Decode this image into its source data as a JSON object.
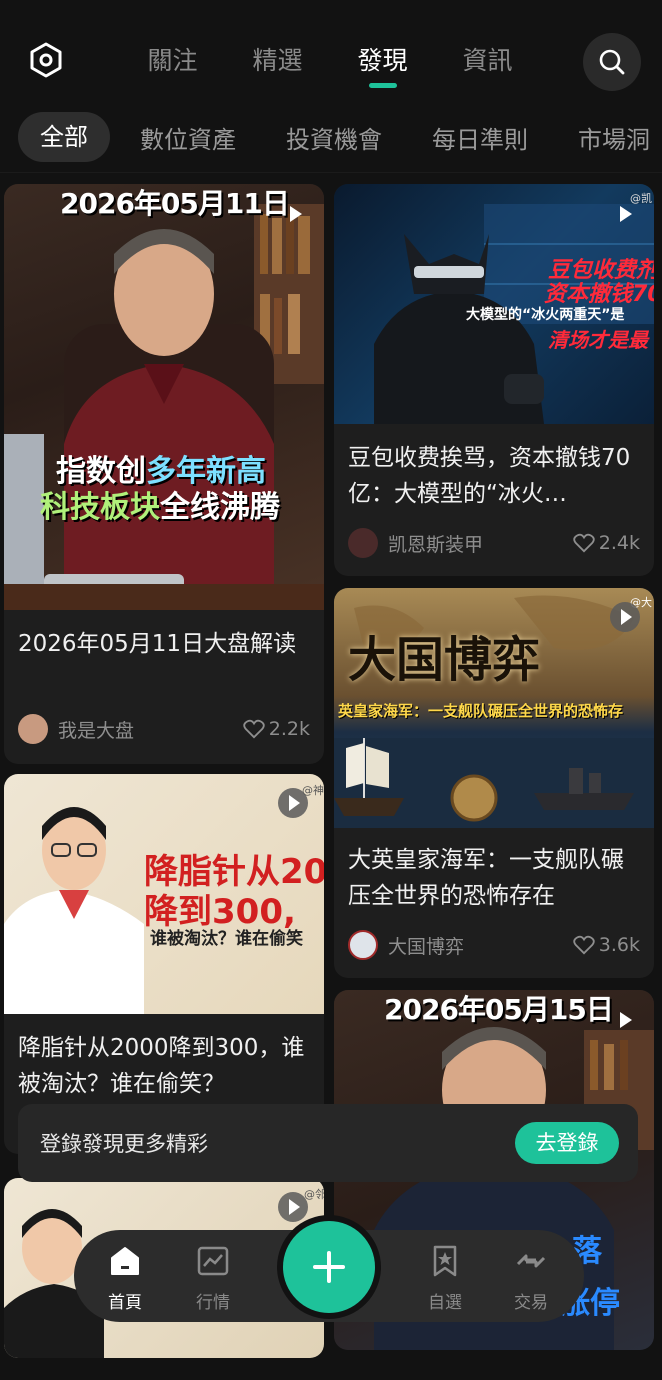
{
  "header": {
    "tabs": [
      {
        "label": "關注",
        "active": false
      },
      {
        "label": "精選",
        "active": false
      },
      {
        "label": "發現",
        "active": true
      },
      {
        "label": "資訊",
        "active": false
      }
    ],
    "left_icon": "hexagon-settings-icon",
    "right_icon": "search-icon"
  },
  "categories": [
    "全部",
    "數位資產",
    "投資機會",
    "每日準則",
    "市場洞"
  ],
  "accent_color": "#1ec29a",
  "cards": [
    {
      "overlay_date": "2026年05月11日",
      "overlay_line1a": "指数创",
      "overlay_line1b": "多年新高",
      "overlay_line2a": "科技板块",
      "overlay_line2b": "全线沸腾",
      "title": "2026年05月11日大盘解读",
      "author": "我是大盘",
      "likes": "2.2k"
    },
    {
      "overlay_1": "豆包收费剂",
      "overlay_2": "资本撤钱70",
      "overlay_3": "大模型的“冰火两重天”是",
      "overlay_4": "清场才是最",
      "overlay_tag": "@凯",
      "title": "豆包收费挨骂，资本撤钱70亿：大模型的“冰火…",
      "author": "凯恩斯装甲",
      "likes": "2.4k"
    },
    {
      "overlay_big": "大国博弈",
      "overlay_sub": "英皇家海军：一支舰队碾压全世界的恐怖存",
      "overlay_tag": "@大",
      "title": "大英皇家海军：一支舰队碾压全世界的恐怖存在",
      "author": "大国博弈",
      "likes": "3.6k"
    },
    {
      "overlay_1": "降脂针从20",
      "overlay_2": "降到300,",
      "overlay_3": "谁被淘汰？谁在偷笑",
      "overlay_tag": "@神经",
      "title": "降脂针从2000降到300，谁被淘汰？谁在偷笑？"
    },
    {
      "overlay_date": "2026年05月15日",
      "overlay_1": "落",
      "overlay_2": "涨停"
    },
    {
      "overlay_tag": "@邻"
    }
  ],
  "login_banner": {
    "text": "登錄發現更多精彩",
    "button": "去登錄"
  },
  "bottom_nav": [
    {
      "label": "首頁",
      "icon": "home-icon",
      "active": true
    },
    {
      "label": "行情",
      "icon": "chart-icon",
      "active": false
    },
    {
      "label": "自選",
      "icon": "bookmark-star-icon",
      "active": false
    },
    {
      "label": "交易",
      "icon": "exchange-icon",
      "active": false
    }
  ],
  "fab_icon": "plus-icon"
}
